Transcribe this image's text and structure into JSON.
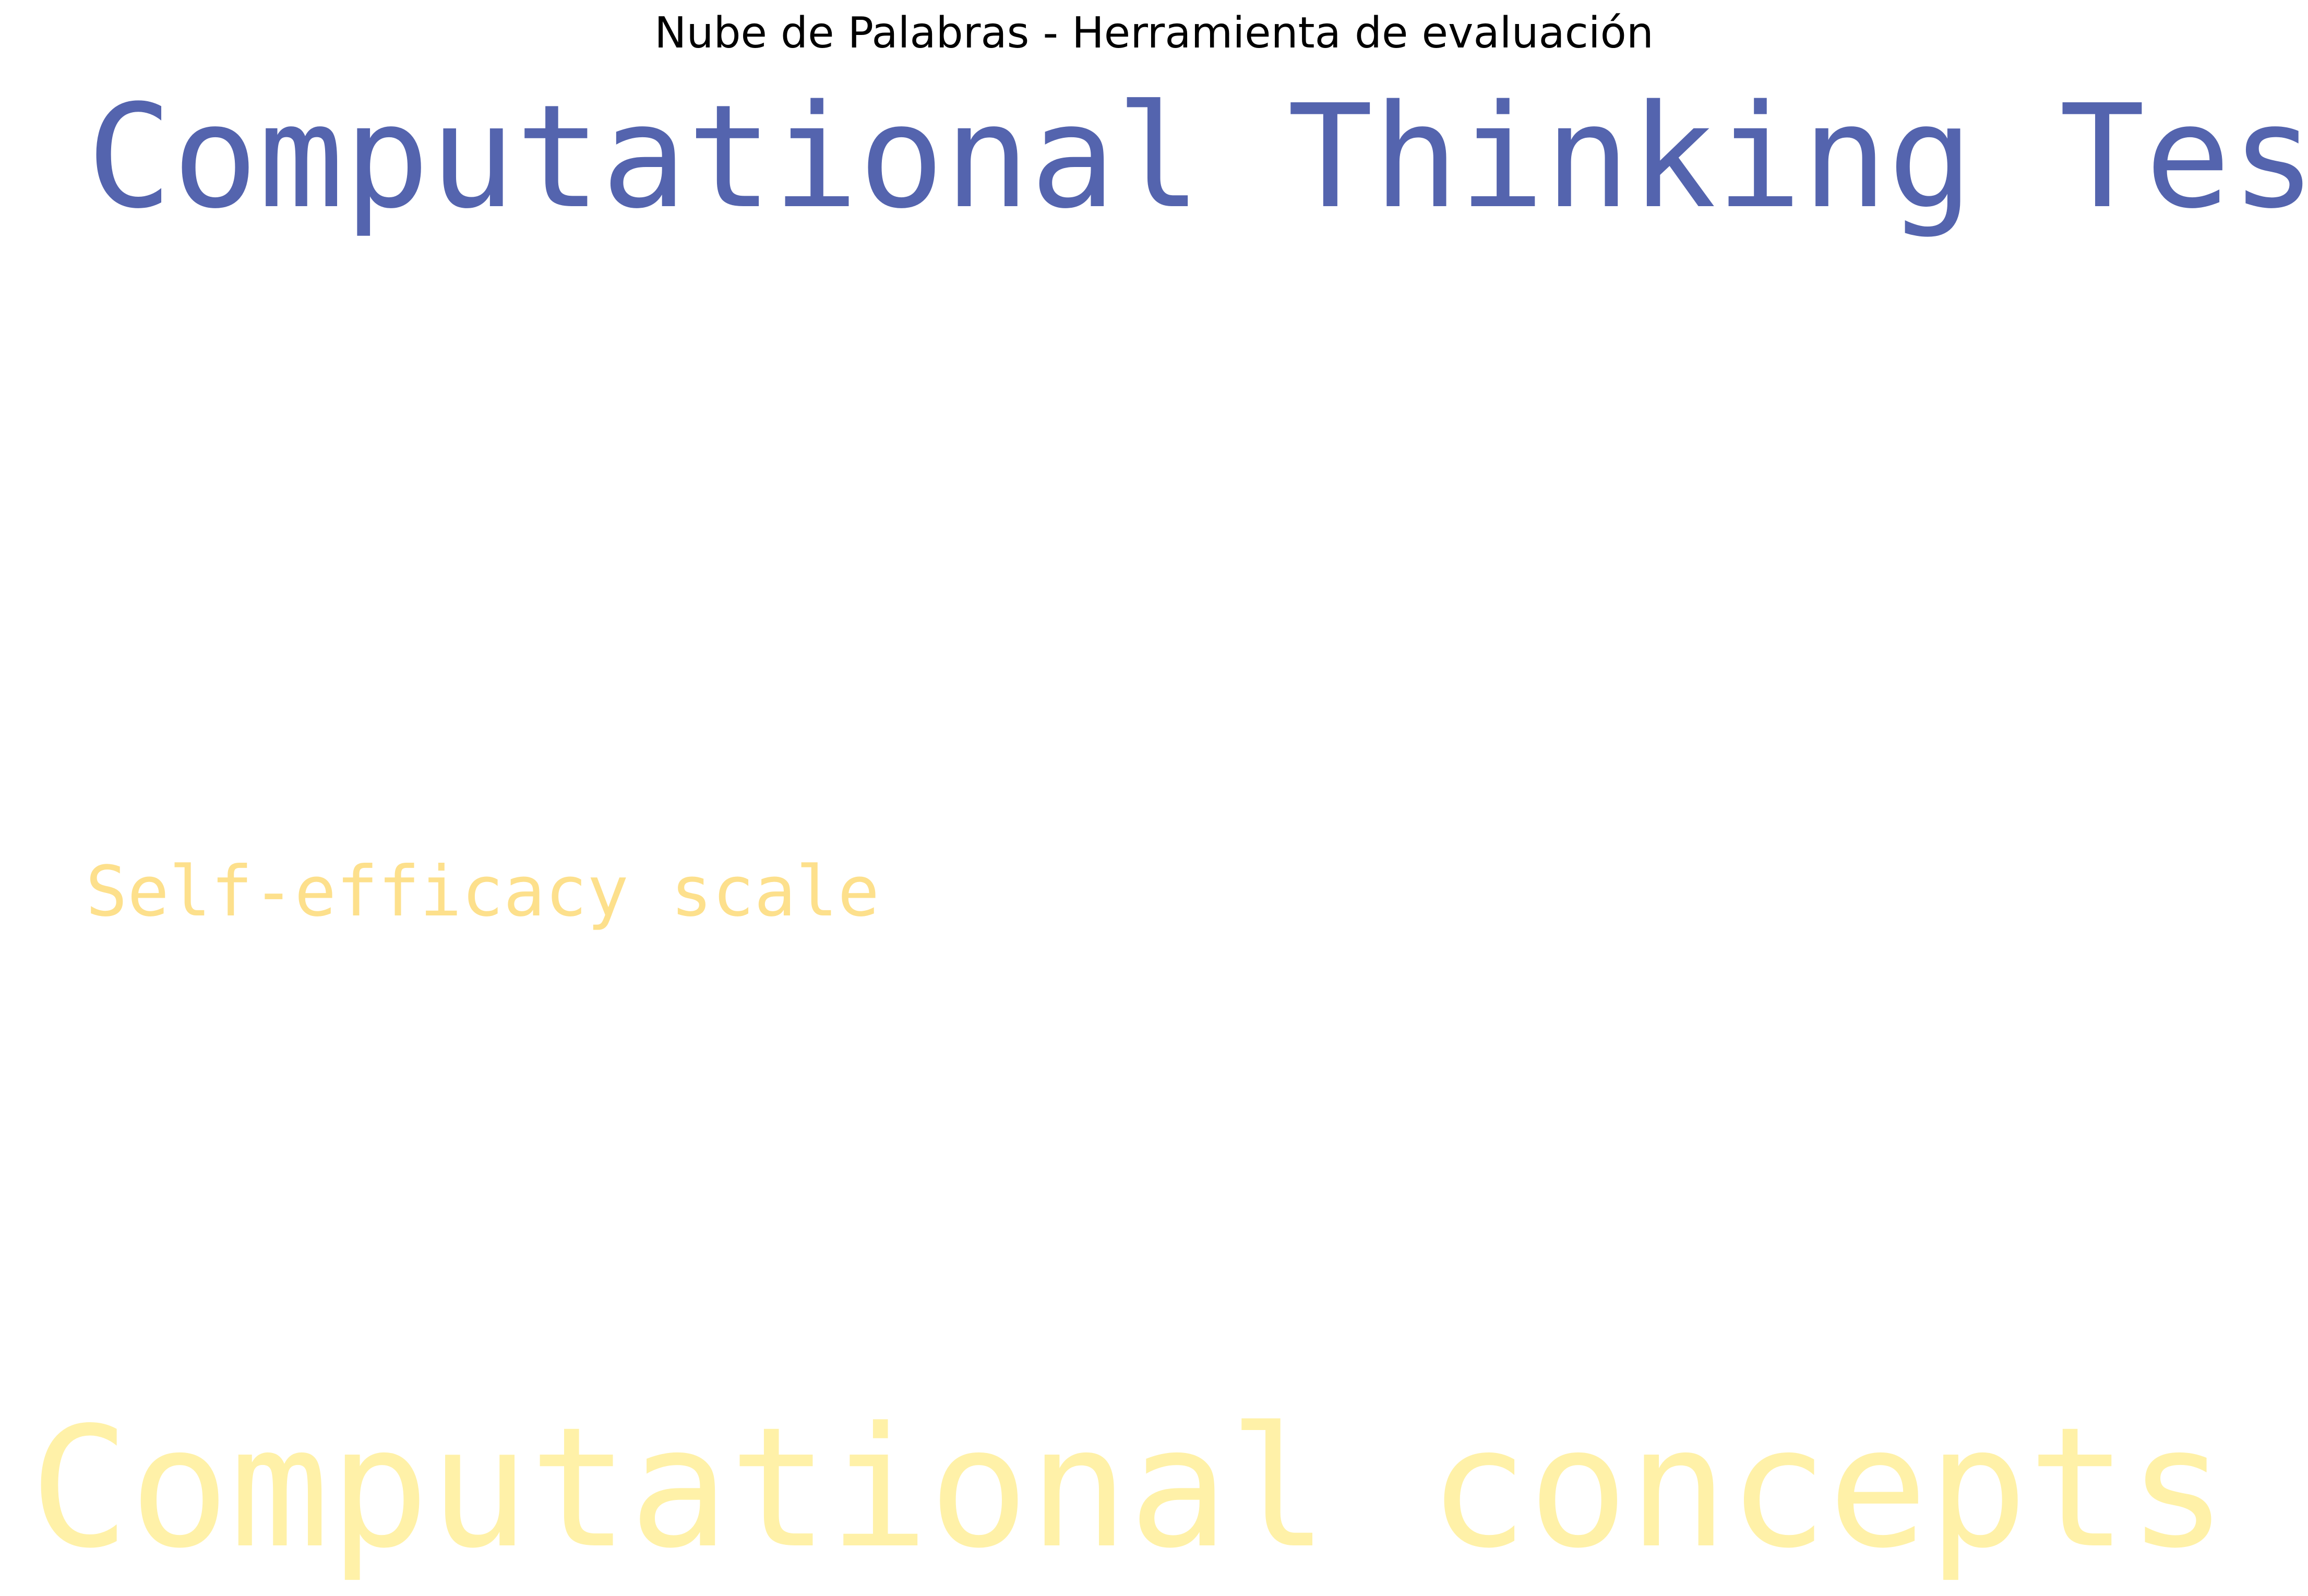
{
  "title": "Nube de Palabras - Herramienta de evaluación",
  "words": [
    {
      "text": "Computational Thinking Test",
      "color": "#5464ae"
    },
    {
      "text": "Self-efficacy scale",
      "color": "#fde08c"
    },
    {
      "text": "Computational concepts",
      "color": "#fff1a8"
    }
  ]
}
